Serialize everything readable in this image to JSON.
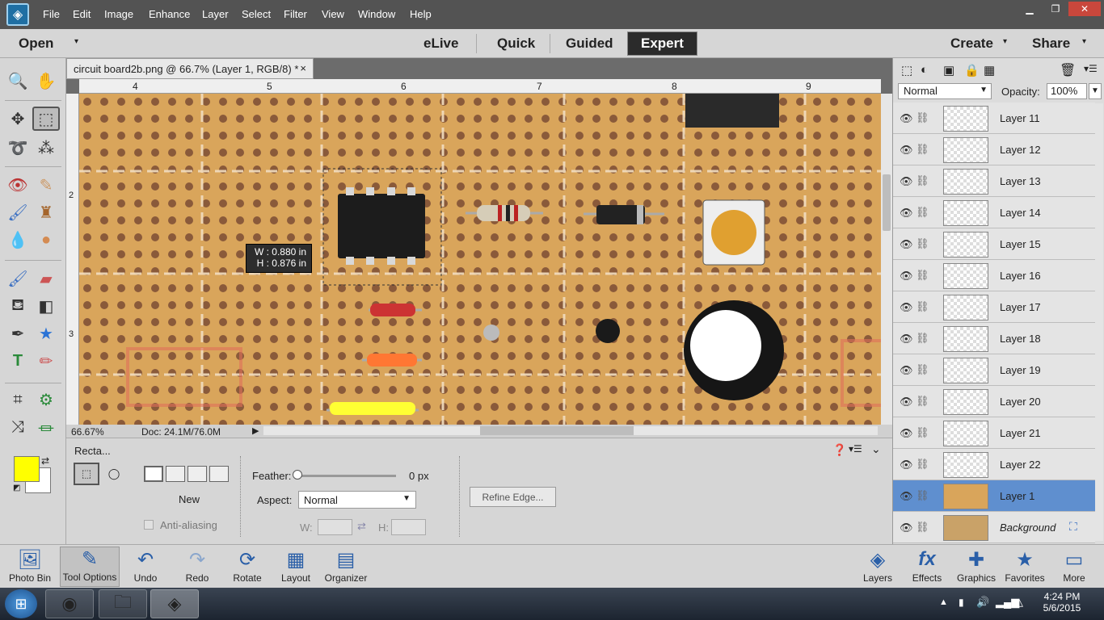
{
  "menubar": {
    "items": [
      "File",
      "Edit",
      "Image",
      "Enhance",
      "Layer",
      "Select",
      "Filter",
      "View",
      "Window",
      "Help"
    ]
  },
  "modebar": {
    "open": "Open",
    "modes": [
      "eLive",
      "Quick",
      "Guided",
      "Expert"
    ],
    "create": "Create",
    "share": "Share"
  },
  "document": {
    "tab_title": "circuit board2b.png @ 66.7% (Layer 1, RGB/8) *",
    "close": "×"
  },
  "ruler": {
    "top": [
      "4",
      "5",
      "6",
      "7",
      "8",
      "9"
    ],
    "left": [
      "2",
      "3"
    ]
  },
  "selection_info": {
    "w": "W : 0.880 in",
    "h": "H : 0.876 in"
  },
  "status": {
    "zoom": "66.67%",
    "doc": "Doc: 24.1M/76.0M"
  },
  "options": {
    "tool_name": "Recta...",
    "new_label": "New",
    "antialias": "Anti-aliasing",
    "feather_label": "Feather:",
    "feather_value": "0 px",
    "aspect_label": "Aspect:",
    "aspect_value": "Normal",
    "w_label": "W:",
    "h_label": "H:",
    "refine_edge": "Refine Edge..."
  },
  "layers": {
    "blend_mode": "Normal",
    "opacity_label": "Opacity:",
    "opacity_value": "100%",
    "items": [
      "Layer 11",
      "Layer 12",
      "Layer 13",
      "Layer 14",
      "Layer 15",
      "Layer 16",
      "Layer 17",
      "Layer 18",
      "Layer 19",
      "Layer 20",
      "Layer 21",
      "Layer 22",
      "Layer 1",
      "Background"
    ]
  },
  "bottombar": {
    "left": [
      "Photo Bin",
      "Tool Options",
      "Undo",
      "Redo",
      "Rotate",
      "Layout",
      "Organizer"
    ],
    "right": [
      "Layers",
      "Effects",
      "Graphics",
      "Favorites",
      "More"
    ]
  },
  "taskbar": {
    "time": "4:24 PM",
    "date": "5/6/2015"
  },
  "colors": {
    "foreground": "#ffff00",
    "background": "#ffffff",
    "selected_layer": "#5f8fcf"
  }
}
